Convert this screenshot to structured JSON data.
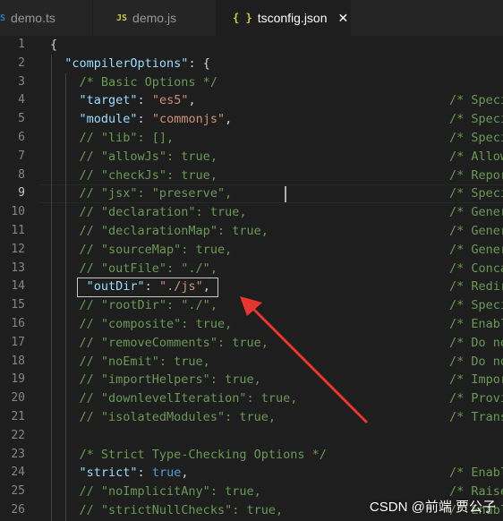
{
  "tabs": [
    {
      "icon_text": "TS",
      "icon": "typescript-file-icon",
      "label": "demo.ts",
      "active": false
    },
    {
      "icon_text": "JS",
      "icon": "javascript-file-icon",
      "label": "demo.js",
      "active": false
    },
    {
      "icon_text": "{ }",
      "icon": "json-file-icon",
      "label": "tsconfig.json",
      "active": true,
      "close": "✕"
    }
  ],
  "editor": {
    "current_line": 9,
    "lines": [
      {
        "n": 1,
        "segs": [
          [
            "pun",
            "{"
          ]
        ]
      },
      {
        "n": 2,
        "segs": [
          [
            "pun",
            "  "
          ],
          [
            "key",
            "\"compilerOptions\""
          ],
          [
            "pun",
            ": {"
          ]
        ]
      },
      {
        "n": 3,
        "segs": [
          [
            "pun",
            "    "
          ],
          [
            "com",
            "/* Basic Options */"
          ]
        ]
      },
      {
        "n": 4,
        "segs": [
          [
            "pun",
            "    "
          ],
          [
            "key",
            "\"target\""
          ],
          [
            "pun",
            ": "
          ],
          [
            "str",
            "\"es5\""
          ],
          [
            "pun",
            ","
          ]
        ],
        "trail": "/* Specify ECMA"
      },
      {
        "n": 5,
        "segs": [
          [
            "pun",
            "    "
          ],
          [
            "key",
            "\"module\""
          ],
          [
            "pun",
            ": "
          ],
          [
            "str",
            "\"commonjs\""
          ],
          [
            "pun",
            ","
          ]
        ],
        "trail": "/* Specify modu"
      },
      {
        "n": 6,
        "segs": [
          [
            "pun",
            "    "
          ],
          [
            "com",
            "// \"lib\": [],"
          ]
        ],
        "trail": "/* Specify libr"
      },
      {
        "n": 7,
        "segs": [
          [
            "pun",
            "    "
          ],
          [
            "com",
            "// \"allowJs\": true,"
          ]
        ],
        "trail": "/* Allow javasc"
      },
      {
        "n": 8,
        "segs": [
          [
            "pun",
            "    "
          ],
          [
            "com",
            "// \"checkJs\": true,"
          ]
        ],
        "trail": "/* Report error"
      },
      {
        "n": 9,
        "segs": [
          [
            "pun",
            "    "
          ],
          [
            "com",
            "// \"jsx\": \"preserve\","
          ]
        ],
        "trail": "/* Specify JSX"
      },
      {
        "n": 10,
        "segs": [
          [
            "pun",
            "    "
          ],
          [
            "com",
            "// \"declaration\": true,"
          ]
        ],
        "trail": "/* Generates co"
      },
      {
        "n": 11,
        "segs": [
          [
            "pun",
            "    "
          ],
          [
            "com",
            "// \"declarationMap\": true,"
          ]
        ],
        "trail": "/* Generates a"
      },
      {
        "n": 12,
        "segs": [
          [
            "pun",
            "    "
          ],
          [
            "com",
            "// \"sourceMap\": true,"
          ]
        ],
        "trail": "/* Generates co"
      },
      {
        "n": 13,
        "segs": [
          [
            "pun",
            "    "
          ],
          [
            "com",
            "// \"outFile\": \"./\","
          ]
        ],
        "trail": "/* Concatenate"
      },
      {
        "n": 14,
        "segs": [
          [
            "pun",
            "     "
          ],
          [
            "key",
            "\"outDir\""
          ],
          [
            "pun",
            ": "
          ],
          [
            "str",
            "\"./js\""
          ],
          [
            "pun",
            ","
          ]
        ],
        "trail": "/* Redirect out"
      },
      {
        "n": 15,
        "segs": [
          [
            "pun",
            "    "
          ],
          [
            "com",
            "// \"rootDir\": \"./\","
          ]
        ],
        "trail": "/* Specify the"
      },
      {
        "n": 16,
        "segs": [
          [
            "pun",
            "    "
          ],
          [
            "com",
            "// \"composite\": true,"
          ]
        ],
        "trail": "/* Enable proje"
      },
      {
        "n": 17,
        "segs": [
          [
            "pun",
            "    "
          ],
          [
            "com",
            "// \"removeComments\": true,"
          ]
        ],
        "trail": "/* Do not emit"
      },
      {
        "n": 18,
        "segs": [
          [
            "pun",
            "    "
          ],
          [
            "com",
            "// \"noEmit\": true,"
          ]
        ],
        "trail": "/* Do not emit"
      },
      {
        "n": 19,
        "segs": [
          [
            "pun",
            "    "
          ],
          [
            "com",
            "// \"importHelpers\": true,"
          ]
        ],
        "trail": "/* Import emit"
      },
      {
        "n": 20,
        "segs": [
          [
            "pun",
            "    "
          ],
          [
            "com",
            "// \"downlevelIteration\": true,"
          ]
        ],
        "trail": "/* Provide full"
      },
      {
        "n": 21,
        "segs": [
          [
            "pun",
            "    "
          ],
          [
            "com",
            "// \"isolatedModules\": true,"
          ]
        ],
        "trail": "/* Transpile ea"
      },
      {
        "n": 22,
        "segs": []
      },
      {
        "n": 23,
        "segs": [
          [
            "pun",
            "    "
          ],
          [
            "com",
            "/* Strict Type-Checking Options */"
          ]
        ]
      },
      {
        "n": 24,
        "segs": [
          [
            "pun",
            "    "
          ],
          [
            "key",
            "\"strict\""
          ],
          [
            "pun",
            ": "
          ],
          [
            "kw",
            "true"
          ],
          [
            "pun",
            ","
          ]
        ],
        "trail": "/* Enable all s"
      },
      {
        "n": 25,
        "segs": [
          [
            "pun",
            "    "
          ],
          [
            "com",
            "// \"noImplicitAny\": true,"
          ]
        ],
        "trail": "/* Raise error"
      },
      {
        "n": 26,
        "segs": [
          [
            "pun",
            "    "
          ],
          [
            "com",
            "// \"strictNullChecks\": true,"
          ]
        ],
        "trail": "/* Enable stric"
      }
    ]
  },
  "watermark": "CSDN @前端 贾公子",
  "colors": {
    "background": "#1e1e1e",
    "arrow": "#e8352f",
    "comment": "#6a9955",
    "key": "#9cdcfe",
    "string": "#ce9178"
  }
}
